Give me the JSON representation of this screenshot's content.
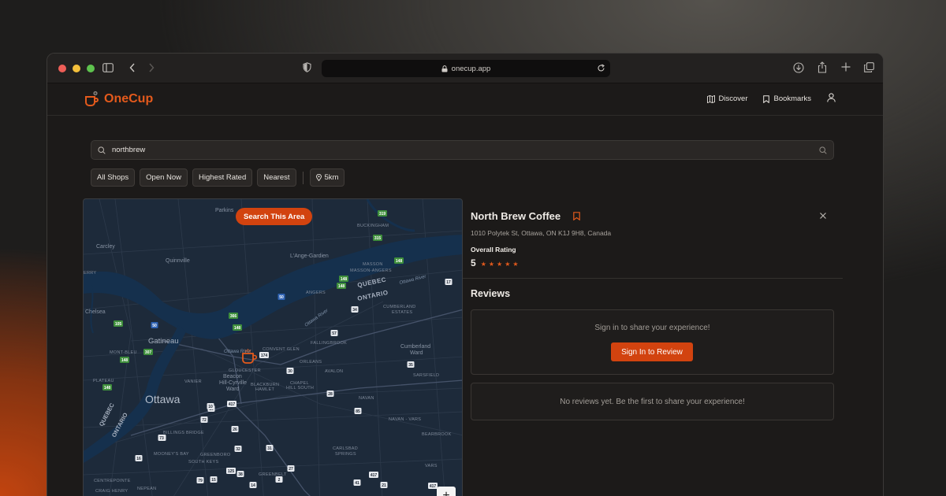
{
  "browser": {
    "url": "onecup.app"
  },
  "app": {
    "brand": "OneCup",
    "brand_color": "#e45a1c",
    "nav": [
      {
        "label": "Discover",
        "icon": "map-icon"
      },
      {
        "label": "Bookmarks",
        "icon": "bookmark-icon"
      }
    ]
  },
  "search": {
    "value": "northbrew"
  },
  "filters": {
    "chips": [
      "All Shops",
      "Open Now",
      "Highest Rated",
      "Nearest"
    ],
    "distance": "5km"
  },
  "map": {
    "search_area_label": "Search This Area",
    "zoom_in": "+",
    "labels": [
      {
        "text": "Parkins",
        "cls": "sm"
      },
      {
        "text": "BUCKINGHAM",
        "cls": "cap"
      },
      {
        "text": "Carcley",
        "cls": "sm"
      },
      {
        "text": "Quinnville",
        "cls": "sm"
      },
      {
        "text": "L'Ange-Gardien",
        "cls": "sm"
      },
      {
        "text": "MASSON",
        "cls": "cap"
      },
      {
        "text": "MASSON-ANGERS",
        "cls": "cap"
      },
      {
        "text": "QUEBEC",
        "cls": "prov"
      },
      {
        "text": "ONTARIO",
        "cls": "prov"
      },
      {
        "text": "ANGERS",
        "cls": "cap"
      },
      {
        "text": "CUMBERLAND",
        "cls": "cap"
      },
      {
        "text": "ESTATES",
        "cls": "cap"
      },
      {
        "text": "Chelsea",
        "cls": "sm"
      },
      {
        "text": "Gatineau",
        "cls": "city"
      },
      {
        "text": "MONT-BLEU",
        "cls": "cap"
      },
      {
        "text": "CONVENT GLEN",
        "cls": "cap"
      },
      {
        "text": "FALLINGBROOK",
        "cls": "cap"
      },
      {
        "text": "Cumberland",
        "cls": "sm"
      },
      {
        "text": "Ward",
        "cls": "sm"
      },
      {
        "text": "ORLEANS",
        "cls": "cap"
      },
      {
        "text": "AVALON",
        "cls": "cap"
      },
      {
        "text": "SARSFIELD",
        "cls": "cap"
      },
      {
        "text": "PLATEAU",
        "cls": "cap"
      },
      {
        "text": "VANIER",
        "cls": "cap"
      },
      {
        "text": "GLOUCESTER",
        "cls": "cap"
      },
      {
        "text": "Beacon",
        "cls": "sm"
      },
      {
        "text": "Hill-Cyrville",
        "cls": "sm"
      },
      {
        "text": "Ward",
        "cls": "sm"
      },
      {
        "text": "BLACKBURN",
        "cls": "cap"
      },
      {
        "text": "HAMLET",
        "cls": "cap"
      },
      {
        "text": "CHAPEL",
        "cls": "cap"
      },
      {
        "text": "HILL SOUTH",
        "cls": "cap"
      },
      {
        "text": "Ottawa",
        "cls": "big"
      },
      {
        "text": "NAVAN",
        "cls": "cap"
      },
      {
        "text": "QUEBEC",
        "cls": "provr"
      },
      {
        "text": "ONTARIO",
        "cls": "provr"
      },
      {
        "text": "NAVAN - VARS",
        "cls": "cap"
      },
      {
        "text": "BILLINGS BRIDGE",
        "cls": "cap"
      },
      {
        "text": "BEARBROOK",
        "cls": "cap"
      },
      {
        "text": "MOONEY'S BAY",
        "cls": "cap"
      },
      {
        "text": "GREENBORO",
        "cls": "cap"
      },
      {
        "text": "SOUTH KEYS",
        "cls": "cap"
      },
      {
        "text": "CARLSBAD",
        "cls": "cap"
      },
      {
        "text": "SPRINGS",
        "cls": "cap"
      },
      {
        "text": "VARS",
        "cls": "cap"
      },
      {
        "text": "CENTREPOINTE",
        "cls": "cap"
      },
      {
        "text": "GREENBELT",
        "cls": "cap"
      },
      {
        "text": "CRAIG HENRY",
        "cls": "cap"
      },
      {
        "text": "NEPEAN",
        "cls": "cap"
      },
      {
        "text": "Ottawa River",
        "cls": "river"
      },
      {
        "text": "Ottawa River",
        "cls": "river"
      },
      {
        "text": "Ottawa River",
        "cls": "river"
      },
      {
        "text": "ERRY",
        "cls": "cap"
      }
    ],
    "shields": [
      {
        "text": "319",
        "kind": "green"
      },
      {
        "text": "315",
        "kind": "green"
      },
      {
        "text": "148",
        "kind": "green"
      },
      {
        "text": "148",
        "kind": "green"
      },
      {
        "text": "50",
        "kind": "blue"
      },
      {
        "text": "148",
        "kind": "green"
      },
      {
        "text": "366",
        "kind": "green"
      },
      {
        "text": "148",
        "kind": "green"
      },
      {
        "text": "105",
        "kind": "green"
      },
      {
        "text": "50",
        "kind": "blue"
      },
      {
        "text": "307",
        "kind": "green"
      },
      {
        "text": "148",
        "kind": "green"
      },
      {
        "text": "148",
        "kind": "green"
      },
      {
        "text": "17",
        "kind": "white"
      },
      {
        "text": "34",
        "kind": "white"
      },
      {
        "text": "57",
        "kind": "white"
      },
      {
        "text": "174",
        "kind": "white"
      },
      {
        "text": "30",
        "kind": "white"
      },
      {
        "text": "35",
        "kind": "white"
      },
      {
        "text": "28",
        "kind": "white"
      },
      {
        "text": "417",
        "kind": "white"
      },
      {
        "text": "10",
        "kind": "white"
      },
      {
        "text": "72",
        "kind": "white"
      },
      {
        "text": "85",
        "kind": "white"
      },
      {
        "text": "26",
        "kind": "white"
      },
      {
        "text": "73",
        "kind": "white"
      },
      {
        "text": "32",
        "kind": "white"
      },
      {
        "text": "16",
        "kind": "white"
      },
      {
        "text": "31",
        "kind": "white"
      },
      {
        "text": "27",
        "kind": "white"
      },
      {
        "text": "125",
        "kind": "white"
      },
      {
        "text": "38",
        "kind": "white"
      },
      {
        "text": "417",
        "kind": "white"
      },
      {
        "text": "79",
        "kind": "white"
      },
      {
        "text": "15",
        "kind": "white"
      },
      {
        "text": "14",
        "kind": "white"
      },
      {
        "text": "41",
        "kind": "white"
      },
      {
        "text": "21",
        "kind": "white"
      },
      {
        "text": "417",
        "kind": "white"
      },
      {
        "text": "10",
        "kind": "white"
      },
      {
        "text": "73",
        "kind": "white"
      },
      {
        "text": "2",
        "kind": "white"
      }
    ]
  },
  "shop": {
    "name": "North Brew Coffee",
    "address": "1010 Polytek St, Ottawa, ON K1J 9H8, Canada",
    "rating_label": "Overall Rating",
    "rating": "5",
    "stars": "★★★★★"
  },
  "reviews": {
    "heading": "Reviews",
    "signin_prompt": "Sign in to share your experience!",
    "signin_button": "Sign In to Review",
    "empty": "No reviews yet. Be the first to share your experience!"
  }
}
